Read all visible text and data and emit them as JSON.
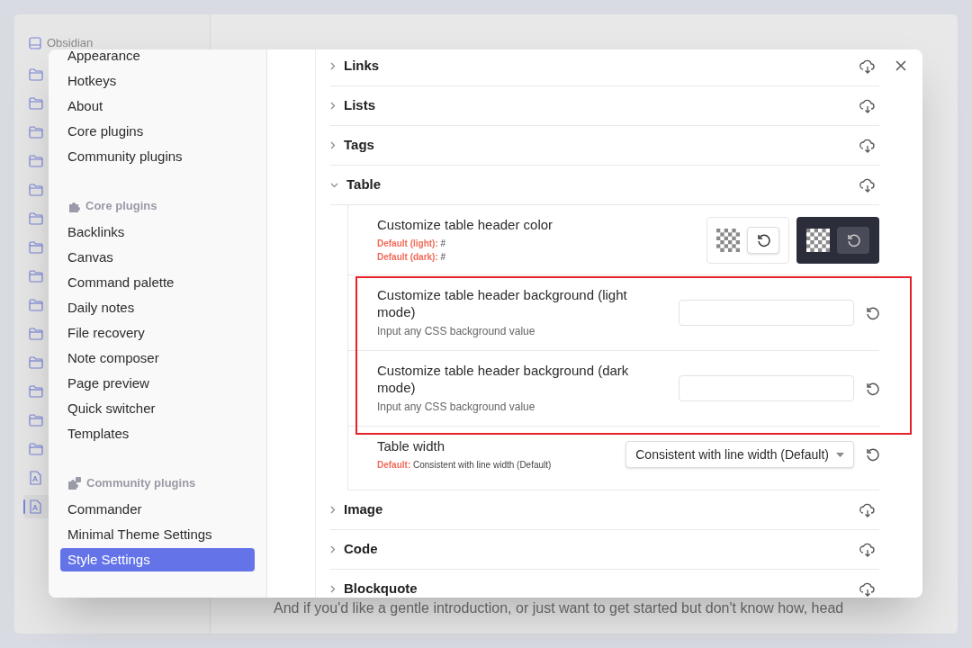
{
  "background": {
    "vault_name": "Obsidian",
    "file_tree": [
      {
        "kind": "folder",
        "selected": false
      },
      {
        "kind": "folder",
        "selected": false
      },
      {
        "kind": "folder",
        "selected": false
      },
      {
        "kind": "folder",
        "selected": false
      },
      {
        "kind": "folder",
        "selected": false
      },
      {
        "kind": "folder",
        "selected": false
      },
      {
        "kind": "folder",
        "selected": false
      },
      {
        "kind": "folder",
        "selected": false
      },
      {
        "kind": "folder",
        "selected": false
      },
      {
        "kind": "folder",
        "selected": false
      },
      {
        "kind": "folder",
        "selected": false
      },
      {
        "kind": "folder",
        "selected": false
      },
      {
        "kind": "folder",
        "selected": false
      },
      {
        "kind": "folder",
        "selected": false
      },
      {
        "kind": "file",
        "selected": false
      },
      {
        "kind": "file",
        "selected": true
      }
    ],
    "body_text": "And if you'd like a gentle introduction, or just want to get started but don't know how, head"
  },
  "settings_sidebar": [
    {
      "items": [
        {
          "label": "Appearance",
          "selected": false
        },
        {
          "label": "Hotkeys",
          "selected": false
        },
        {
          "label": "About",
          "selected": false
        },
        {
          "label": "Core plugins",
          "selected": false
        },
        {
          "label": "Community plugins",
          "selected": false
        }
      ]
    },
    {
      "heading": "Core plugins",
      "kind": "core",
      "items": [
        {
          "label": "Backlinks",
          "selected": false
        },
        {
          "label": "Canvas",
          "selected": false
        },
        {
          "label": "Command palette",
          "selected": false
        },
        {
          "label": "Daily notes",
          "selected": false
        },
        {
          "label": "File recovery",
          "selected": false
        },
        {
          "label": "Note composer",
          "selected": false
        },
        {
          "label": "Page preview",
          "selected": false
        },
        {
          "label": "Quick switcher",
          "selected": false
        },
        {
          "label": "Templates",
          "selected": false
        }
      ]
    },
    {
      "heading": "Community plugins",
      "kind": "community",
      "items": [
        {
          "label": "Commander",
          "selected": false
        },
        {
          "label": "Minimal Theme Settings",
          "selected": false
        },
        {
          "label": "Style Settings",
          "selected": true
        }
      ]
    }
  ],
  "sections": [
    {
      "title": "Links",
      "expanded": false
    },
    {
      "title": "Lists",
      "expanded": false
    },
    {
      "title": "Tags",
      "expanded": false
    },
    {
      "title": "Table",
      "expanded": true,
      "settings": [
        {
          "kind": "color",
          "title": "Customize table header color",
          "defaults": [
            {
              "label": "Default (light):",
              "value": "#"
            },
            {
              "label": "Default (dark):",
              "value": "#"
            }
          ]
        },
        {
          "kind": "group",
          "highlighted": true,
          "settings": [
            {
              "kind": "text",
              "title": "Customize table header background (light mode)",
              "description": "Input any CSS background value"
            },
            {
              "kind": "text",
              "title": "Customize table header background (dark mode)",
              "description": "Input any CSS background value"
            }
          ]
        },
        {
          "kind": "dropdown",
          "title": "Table width",
          "defaults": [
            {
              "label": "Default:",
              "value": "Consistent with line width (Default)"
            }
          ],
          "value": "Consistent with line width (Default)"
        }
      ]
    },
    {
      "title": "Image",
      "expanded": false
    },
    {
      "title": "Code",
      "expanded": false
    },
    {
      "title": "Blockquote",
      "expanded": false
    }
  ]
}
